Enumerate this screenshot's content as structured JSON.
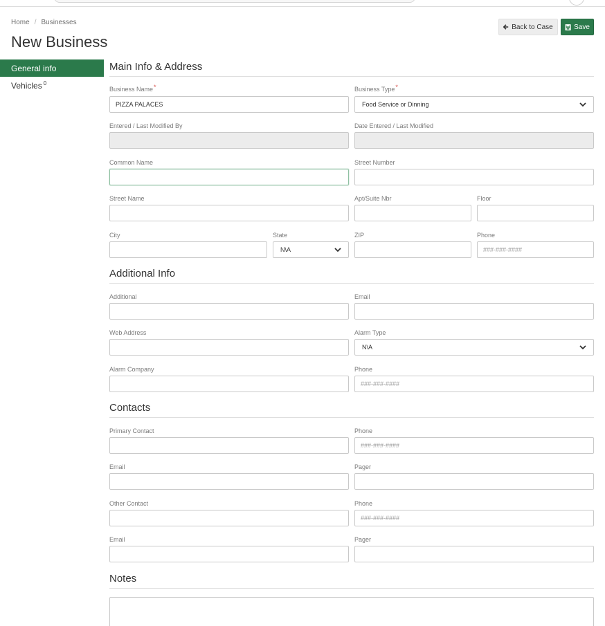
{
  "breadcrumb": {
    "home": "Home",
    "separator": "/",
    "current": "Businesses"
  },
  "page": {
    "title": "New Business"
  },
  "actions": {
    "back_label": "Back to Case",
    "save_label": "Save"
  },
  "sidenav": {
    "items": [
      {
        "label": "General info",
        "active": true
      },
      {
        "label": "Vehicles",
        "count": "0",
        "active": false
      }
    ]
  },
  "sections": {
    "main": "Main Info & Address",
    "additional": "Additional Info",
    "contacts": "Contacts",
    "notes": "Notes"
  },
  "fields": {
    "business_name": {
      "label": "Business Name",
      "required": "*",
      "value": "PIZZA PALACES"
    },
    "business_type": {
      "label": "Business Type",
      "required": "*",
      "value": "Food Service or Dinning"
    },
    "entered_by": {
      "label": "Entered / Last Modified By",
      "value": ""
    },
    "date_entered": {
      "label": "Date Entered / Last Modified",
      "value": ""
    },
    "common_name": {
      "label": "Common Name",
      "value": ""
    },
    "street_number": {
      "label": "Street Number",
      "value": ""
    },
    "street_name": {
      "label": "Street Name",
      "value": ""
    },
    "apt_suite": {
      "label": "Apt/Suite Nbr",
      "value": ""
    },
    "floor": {
      "label": "Floor",
      "value": ""
    },
    "city": {
      "label": "City",
      "value": ""
    },
    "state": {
      "label": "State",
      "value": "N\\A"
    },
    "zip": {
      "label": "ZIP",
      "value": ""
    },
    "phone_main": {
      "label": "Phone",
      "placeholder": "###-###-####"
    },
    "additional": {
      "label": "Additional",
      "value": ""
    },
    "email_additional": {
      "label": "Email",
      "value": ""
    },
    "web_address": {
      "label": "Web Address",
      "value": ""
    },
    "alarm_type": {
      "label": "Alarm Type",
      "value": "N\\A"
    },
    "alarm_company": {
      "label": "Alarm Company",
      "value": ""
    },
    "phone_alarm": {
      "label": "Phone",
      "placeholder": "###-###-####"
    },
    "primary_contact": {
      "label": "Primary Contact",
      "value": ""
    },
    "phone_primary": {
      "label": "Phone",
      "placeholder": "###-###-####"
    },
    "email_primary": {
      "label": "Email",
      "value": ""
    },
    "pager_primary": {
      "label": "Pager",
      "value": ""
    },
    "other_contact": {
      "label": "Other Contact",
      "value": ""
    },
    "phone_other": {
      "label": "Phone",
      "placeholder": "###-###-####"
    },
    "email_other": {
      "label": "Email",
      "value": ""
    },
    "pager_other": {
      "label": "Pager",
      "value": ""
    },
    "notes": {
      "value": ""
    }
  },
  "colors": {
    "accent": "#2b7a4b",
    "required": "#d9534f",
    "disabled_bg": "#ececec"
  }
}
